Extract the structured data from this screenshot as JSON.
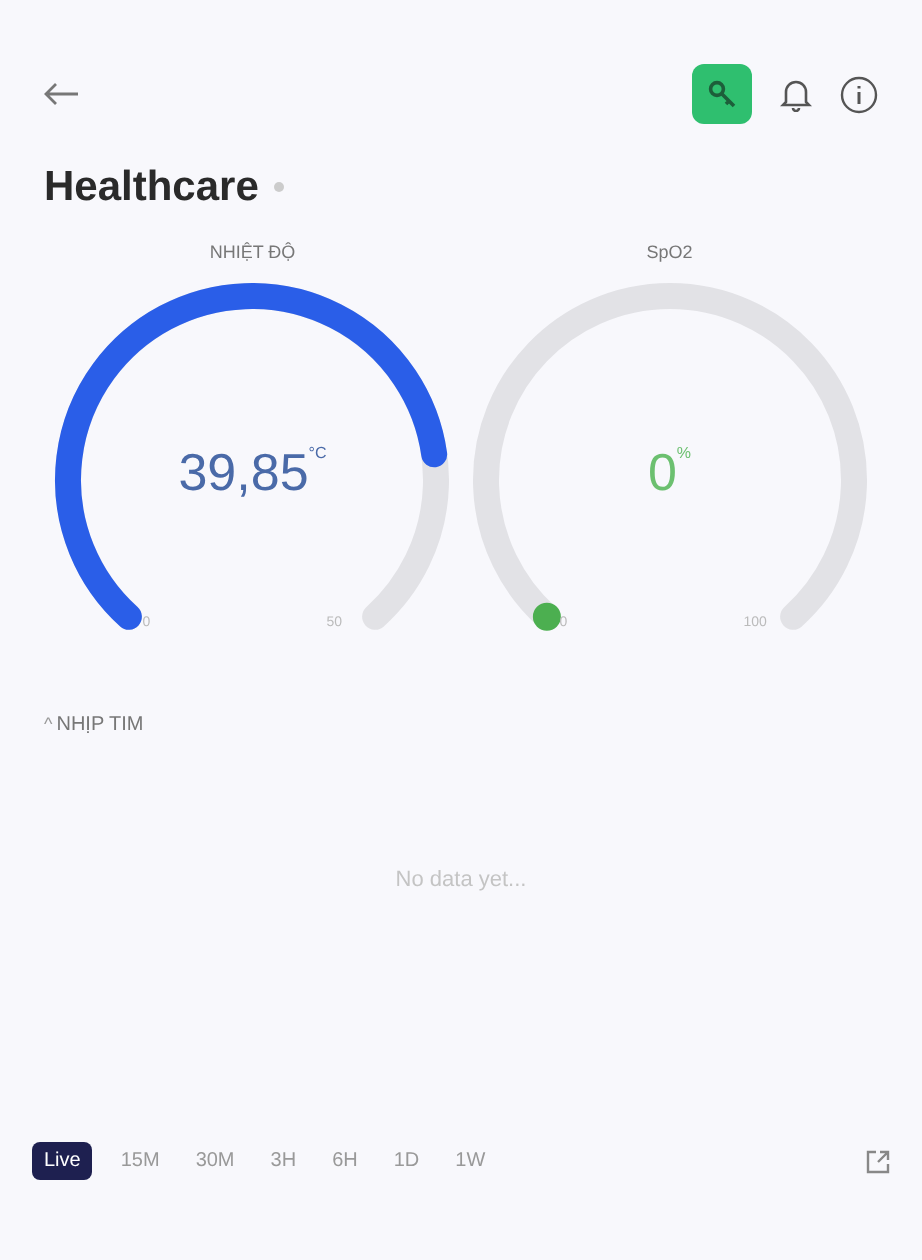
{
  "header": {
    "title": "Healthcare"
  },
  "gauges": [
    {
      "label": "NHIỆT ĐỘ",
      "value": "39,85",
      "unit": "°C",
      "min": "0",
      "max": "50",
      "color": "#2a5ee8"
    },
    {
      "label": "SpO2",
      "value": "0",
      "unit": "%",
      "min": "0",
      "max": "100",
      "color": "#4caf50"
    }
  ],
  "chart": {
    "caret": "^",
    "title": "NHỊP TIM",
    "empty_text": "No data yet..."
  },
  "ranges": [
    {
      "label": "Live",
      "selected": true
    },
    {
      "label": "15M",
      "selected": false
    },
    {
      "label": "30M",
      "selected": false
    },
    {
      "label": "3H",
      "selected": false
    },
    {
      "label": "6H",
      "selected": false
    },
    {
      "label": "1D",
      "selected": false
    },
    {
      "label": "1W",
      "selected": false
    }
  ]
}
